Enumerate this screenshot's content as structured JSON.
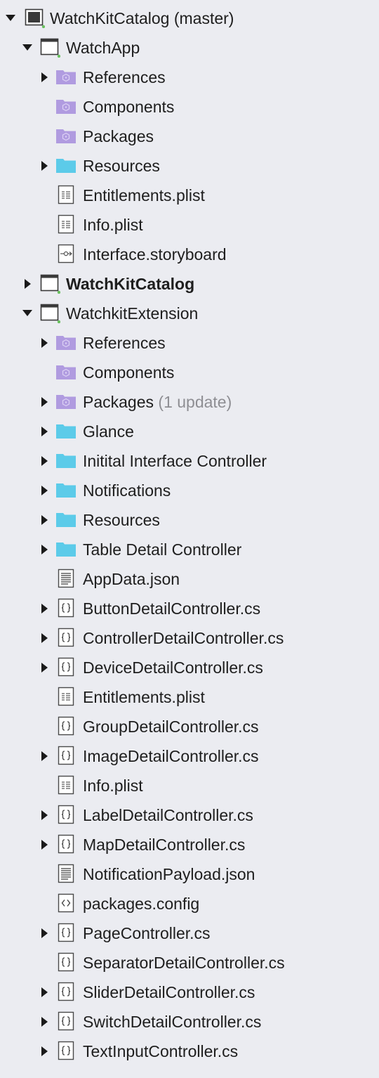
{
  "tree": [
    {
      "label": "WatchKitCatalog (master)",
      "icon": "solution-icon",
      "level": 0,
      "arrow": "expanded",
      "bold": false
    },
    {
      "label": "WatchApp",
      "icon": "project-icon",
      "level": 1,
      "arrow": "expanded",
      "bold": false
    },
    {
      "label": "References",
      "icon": "purple-folder-icon",
      "level": 2,
      "arrow": "collapsed",
      "bold": false
    },
    {
      "label": "Components",
      "icon": "purple-folder-icon",
      "level": 2,
      "arrow": "none",
      "bold": false
    },
    {
      "label": "Packages",
      "icon": "purple-folder-icon",
      "level": 2,
      "arrow": "none",
      "bold": false
    },
    {
      "label": "Resources",
      "icon": "folder-icon",
      "level": 2,
      "arrow": "collapsed",
      "bold": false
    },
    {
      "label": "Entitlements.plist",
      "icon": "plist-file-icon",
      "level": 2,
      "arrow": "none",
      "bold": false
    },
    {
      "label": "Info.plist",
      "icon": "plist-file-icon",
      "level": 2,
      "arrow": "none",
      "bold": false
    },
    {
      "label": "Interface.storyboard",
      "icon": "storyboard-file-icon",
      "level": 2,
      "arrow": "none",
      "bold": false
    },
    {
      "label": "WatchKitCatalog",
      "icon": "project-icon",
      "level": 1,
      "arrow": "collapsed",
      "bold": true
    },
    {
      "label": "WatchkitExtension",
      "icon": "project-icon",
      "level": 1,
      "arrow": "expanded",
      "bold": false
    },
    {
      "label": "References",
      "icon": "purple-folder-icon",
      "level": 2,
      "arrow": "collapsed",
      "bold": false
    },
    {
      "label": "Components",
      "icon": "purple-folder-icon",
      "level": 2,
      "arrow": "none",
      "bold": false
    },
    {
      "label": "Packages",
      "extra": "(1 update)",
      "icon": "purple-folder-icon",
      "level": 2,
      "arrow": "collapsed",
      "bold": false
    },
    {
      "label": "Glance",
      "icon": "folder-icon",
      "level": 2,
      "arrow": "collapsed",
      "bold": false
    },
    {
      "label": "Initital Interface Controller",
      "icon": "folder-icon",
      "level": 2,
      "arrow": "collapsed",
      "bold": false
    },
    {
      "label": "Notifications",
      "icon": "folder-icon",
      "level": 2,
      "arrow": "collapsed",
      "bold": false
    },
    {
      "label": "Resources",
      "icon": "folder-icon",
      "level": 2,
      "arrow": "collapsed",
      "bold": false
    },
    {
      "label": "Table Detail Controller",
      "icon": "folder-icon",
      "level": 2,
      "arrow": "collapsed",
      "bold": false
    },
    {
      "label": "AppData.json",
      "icon": "json-file-icon",
      "level": 2,
      "arrow": "none",
      "bold": false
    },
    {
      "label": "ButtonDetailController.cs",
      "icon": "csharp-file-icon",
      "level": 2,
      "arrow": "collapsed",
      "bold": false
    },
    {
      "label": "ControllerDetailController.cs",
      "icon": "csharp-file-icon",
      "level": 2,
      "arrow": "collapsed",
      "bold": false
    },
    {
      "label": "DeviceDetailController.cs",
      "icon": "csharp-file-icon",
      "level": 2,
      "arrow": "collapsed",
      "bold": false
    },
    {
      "label": "Entitlements.plist",
      "icon": "plist-file-icon",
      "level": 2,
      "arrow": "none",
      "bold": false
    },
    {
      "label": "GroupDetailController.cs",
      "icon": "csharp-file-icon",
      "level": 2,
      "arrow": "none",
      "bold": false
    },
    {
      "label": "ImageDetailController.cs",
      "icon": "csharp-file-icon",
      "level": 2,
      "arrow": "collapsed",
      "bold": false
    },
    {
      "label": "Info.plist",
      "icon": "plist-file-icon",
      "level": 2,
      "arrow": "none",
      "bold": false
    },
    {
      "label": "LabelDetailController.cs",
      "icon": "csharp-file-icon",
      "level": 2,
      "arrow": "collapsed",
      "bold": false
    },
    {
      "label": "MapDetailController.cs",
      "icon": "csharp-file-icon",
      "level": 2,
      "arrow": "collapsed",
      "bold": false
    },
    {
      "label": "NotificationPayload.json",
      "icon": "json-file-icon",
      "level": 2,
      "arrow": "none",
      "bold": false
    },
    {
      "label": "packages.config",
      "icon": "config-file-icon",
      "level": 2,
      "arrow": "none",
      "bold": false
    },
    {
      "label": "PageController.cs",
      "icon": "csharp-file-icon",
      "level": 2,
      "arrow": "collapsed",
      "bold": false
    },
    {
      "label": "SeparatorDetailController.cs",
      "icon": "csharp-file-icon",
      "level": 2,
      "arrow": "none",
      "bold": false
    },
    {
      "label": "SliderDetailController.cs",
      "icon": "csharp-file-icon",
      "level": 2,
      "arrow": "collapsed",
      "bold": false
    },
    {
      "label": "SwitchDetailController.cs",
      "icon": "csharp-file-icon",
      "level": 2,
      "arrow": "collapsed",
      "bold": false
    },
    {
      "label": "TextInputController.cs",
      "icon": "csharp-file-icon",
      "level": 2,
      "arrow": "collapsed",
      "bold": false
    }
  ],
  "colors": {
    "background": "#ebecf1",
    "text": "#1e1e1e",
    "secondary_text": "#8e8e93",
    "folder": "#5ccbe9",
    "purple_folder": "#b09be0",
    "project_badge": "#6ac15f"
  }
}
